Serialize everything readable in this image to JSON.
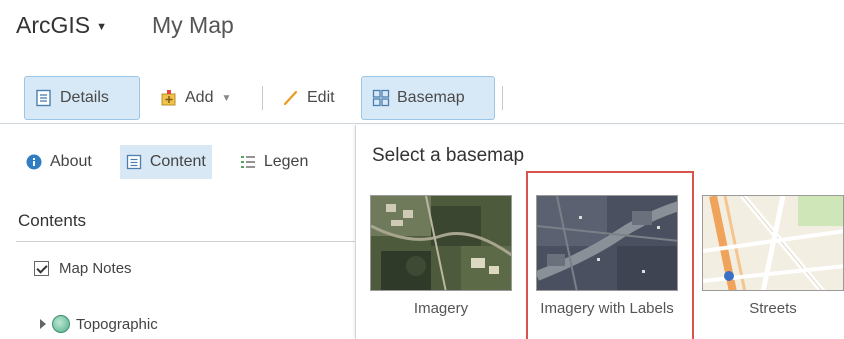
{
  "header": {
    "brand": "ArcGIS",
    "map_title": "My Map"
  },
  "toolbar": {
    "details_label": "Details",
    "add_label": "Add",
    "edit_label": "Edit",
    "basemap_label": "Basemap"
  },
  "left_panel": {
    "tabs": [
      {
        "label": "About",
        "icon": "info-icon"
      },
      {
        "label": "Content",
        "icon": "content-icon"
      },
      {
        "label": "Legen",
        "icon": "legend-icon"
      }
    ],
    "contents_title": "Contents",
    "layers": [
      {
        "label": "Map Notes",
        "checked": true
      },
      {
        "label": "Topographic",
        "icon": "globe-icon"
      }
    ]
  },
  "basemap_gallery": {
    "title": "Select a basemap",
    "items": [
      {
        "label": "Imagery"
      },
      {
        "label": "Imagery with Labels",
        "selected": true
      },
      {
        "label": "Streets"
      }
    ]
  },
  "colors": {
    "active_bg": "#d7e9f7",
    "active_border": "#9cc6e6",
    "selection_red": "#d9534f"
  }
}
